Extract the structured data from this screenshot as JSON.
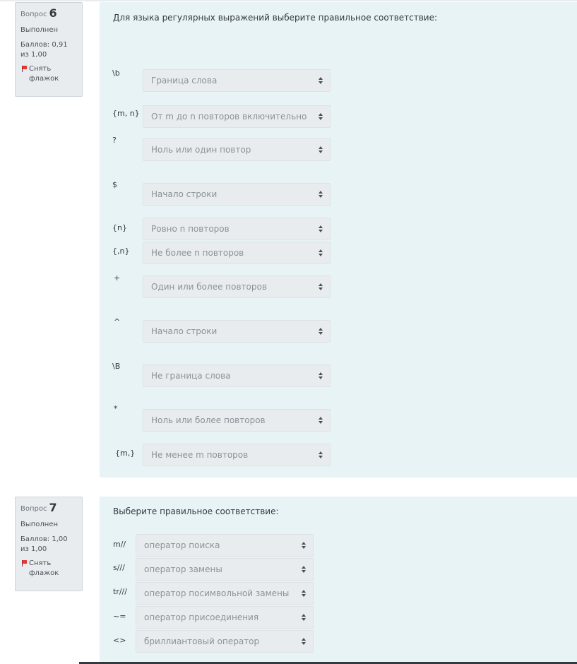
{
  "q6": {
    "number_label": "Вопрос",
    "number": "6",
    "state": "Выполнен",
    "grade": "Баллов: 0,91 из 1,00",
    "flag_label": "Снять флажок",
    "text": "Для языка регулярных выражений выберите правильное соответствие:",
    "rows": [
      {
        "label": "\\b",
        "value": "Граница слова"
      },
      {
        "label": "{m, n}",
        "value": "От m до n повторов включительно"
      },
      {
        "label": "?",
        "value": "Ноль или один повтор"
      },
      {
        "label": "$",
        "value": "Начало строки"
      },
      {
        "label": "{n}",
        "value": "Ровно n повторов"
      },
      {
        "label": "{,n}",
        "value": "Не более n повторов"
      },
      {
        "label": "+",
        "value": "Один или более повторов"
      },
      {
        "label": "^",
        "value": "Начало строки"
      },
      {
        "label": "\\B",
        "value": "Не граница слова"
      },
      {
        "label": "*",
        "value": "Ноль или более повторов"
      },
      {
        "label": "{m,}",
        "value": "Не менее m повторов"
      }
    ]
  },
  "q7": {
    "number_label": "Вопрос",
    "number": "7",
    "state": "Выполнен",
    "grade": "Баллов: 1,00 из 1,00",
    "flag_label": "Снять флажок",
    "text": "Выберите правильное соответствие:",
    "rows": [
      {
        "label": "m//",
        "value": "оператор поиска"
      },
      {
        "label": "s///",
        "value": "оператор замены"
      },
      {
        "label": "tr///",
        "value": "оператор посимвольной замены"
      },
      {
        "label": "~=",
        "value": "оператор присоединения"
      },
      {
        "label": "<>",
        "value": "бриллиантовый оператор"
      }
    ]
  }
}
